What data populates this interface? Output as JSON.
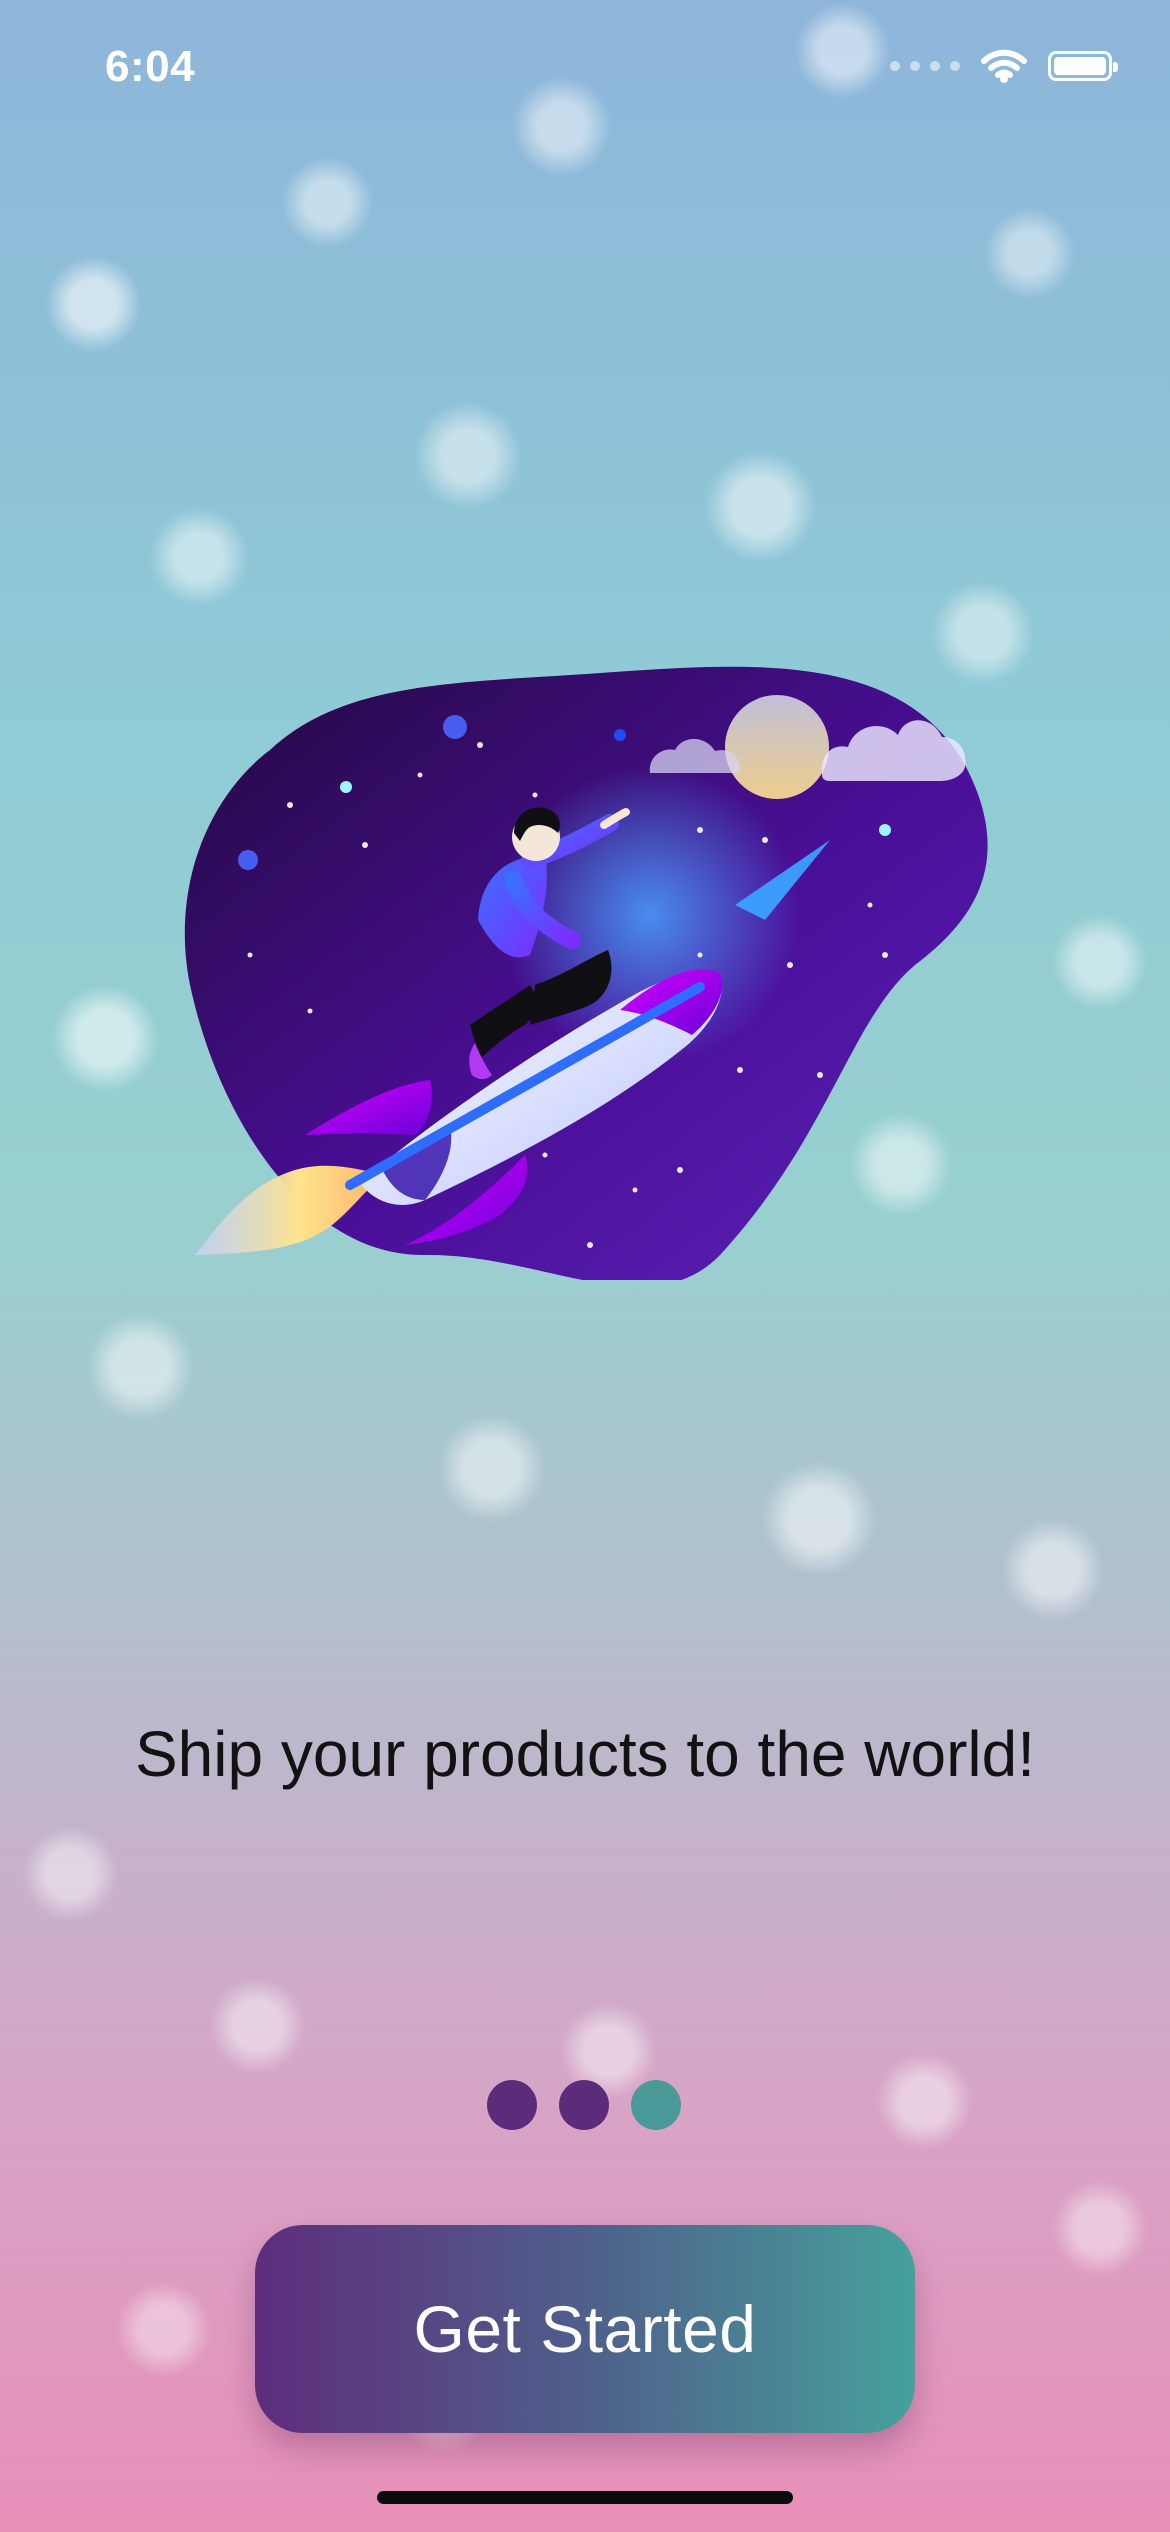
{
  "status_bar": {
    "time": "6:04"
  },
  "onboarding": {
    "headline": "Ship your products to the world!",
    "page_indicator": {
      "total_pages": 3,
      "current_page": 3
    },
    "cta_label": "Get Started"
  },
  "colors": {
    "indicator_inactive": "#5b2c7a",
    "indicator_active": "#4a9a9a",
    "button_gradient_start": "#5e2d7d",
    "button_gradient_end": "#46a19c"
  },
  "icons": {
    "wifi": "wifi-icon",
    "battery": "battery-icon",
    "cellular": "cellular-signal-icon"
  }
}
